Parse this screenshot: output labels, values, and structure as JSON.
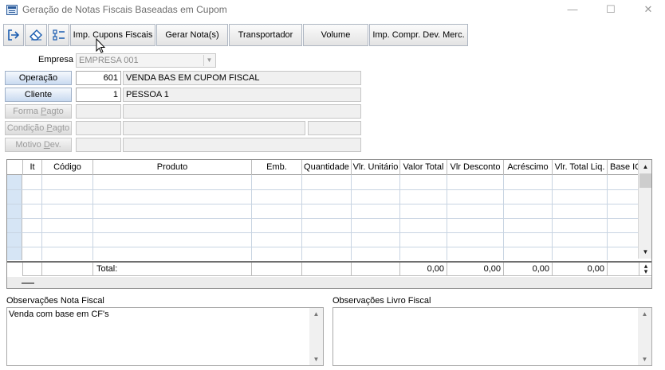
{
  "window": {
    "title": "Geração de Notas Fiscais Baseadas em Cupom",
    "minimize": "—",
    "maximize": "☐",
    "close": "✕"
  },
  "toolbar": {
    "icons": [
      "exit-icon",
      "eraser-icon",
      "tree-icon"
    ],
    "buttons": [
      "Imp. Cupons Fiscais",
      "Gerar Nota(s)",
      "Transportador",
      "Volume",
      "Imp. Compr. Dev. Merc."
    ]
  },
  "form": {
    "empresa_label": "Empresa",
    "empresa_value": "EMPRESA 001",
    "operacao_button": "Operação",
    "operacao_code": "601",
    "operacao_desc": "VENDA BAS EM CUPOM FISCAL",
    "cliente_button": "Cliente",
    "cliente_code": "1",
    "cliente_desc": "PESSOA 1",
    "forma_pagto_pre": "Forma ",
    "forma_pagto_u": "P",
    "forma_pagto_post": "agto",
    "condicao_pagto_pre": "Condição ",
    "condicao_pagto_u": "P",
    "condicao_pagto_post": "agto",
    "motivo_dev_pre": "Motivo ",
    "motivo_dev_u": "D",
    "motivo_dev_post": "ev."
  },
  "grid": {
    "columns": [
      "It",
      "Código",
      "Produto",
      "Emb.",
      "Quantidade",
      "Vlr. Unitário",
      "Valor Total",
      "Vlr Desconto",
      "Acréscimo",
      "Vlr. Total Liq.",
      "Base IC"
    ],
    "total_label": "Total:",
    "totals": {
      "valor_total": "0,00",
      "vlr_desconto": "0,00",
      "acrescimo": "0,00",
      "vlr_total_liq": "0,00"
    }
  },
  "notes": {
    "nota_fiscal_label": "Observações Nota Fiscal",
    "nota_fiscal_text": "Venda com base em CF's",
    "livro_fiscal_label": "Observações Livro Fiscal",
    "livro_fiscal_text": ""
  }
}
